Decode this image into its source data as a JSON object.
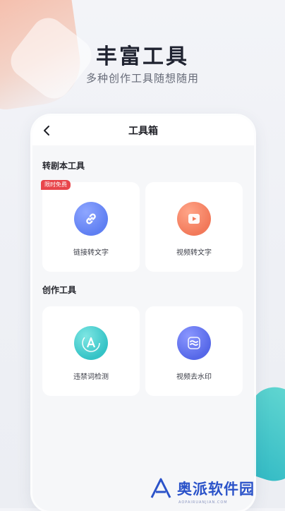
{
  "hero": {
    "title": "丰富工具",
    "subtitle": "多种创作工具随想随用"
  },
  "navbar": {
    "title": "工具箱"
  },
  "sections": {
    "script_tools": {
      "title": "转剧本工具",
      "items": [
        {
          "label": "链接转文字",
          "badge": "限时免费",
          "icon": "link-icon",
          "color": "#5f7ff2"
        },
        {
          "label": "视频转文字",
          "icon": "play-icon",
          "color": "#f2795a"
        }
      ]
    },
    "creation_tools": {
      "title": "创作工具",
      "items": [
        {
          "label": "违禁词检测",
          "icon": "letter-a-icon",
          "color": "#34c3c6"
        },
        {
          "label": "视频去水印",
          "icon": "waves-icon",
          "color": "#5668e8"
        }
      ]
    }
  },
  "watermark": {
    "name": "奥派软件园",
    "url": "AOPAIRUANJIAN.COM"
  },
  "colors": {
    "badge": "#e8454b",
    "background": "#f3f4f8",
    "watermark": "#2b53c9"
  }
}
